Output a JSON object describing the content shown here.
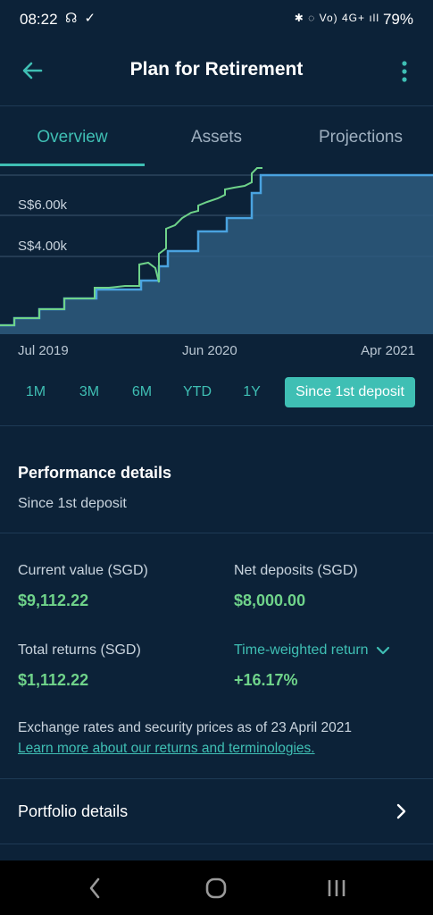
{
  "status_bar": {
    "time": "08:22",
    "battery": "79%",
    "left_icons": "☊ ✓",
    "right_icons": "✱ ◌ Vo) 4G+ ıll"
  },
  "app_bar": {
    "title": "Plan for Retirement"
  },
  "tabs": [
    {
      "label": "Overview",
      "active": true
    },
    {
      "label": "Assets",
      "active": false
    },
    {
      "label": "Projections",
      "active": false
    }
  ],
  "chart": {
    "y_labels": [
      "S$6.00k",
      "S$4.00k"
    ],
    "x_labels": [
      "Jul 2019",
      "Jun 2020",
      "Apr 2021"
    ]
  },
  "chart_data": {
    "type": "area",
    "x_labels": [
      "Jul 2019",
      "Jun 2020",
      "Apr 2021"
    ],
    "y_tick_labels": [
      "S$4.00k",
      "S$6.00k"
    ],
    "series": [
      {
        "values": [
          1000,
          1000,
          1000,
          1500,
          1500,
          2000,
          2000,
          2500,
          2500,
          3000,
          3000,
          3500,
          4000,
          5000,
          5500,
          6000,
          6500,
          7000,
          7500,
          8000,
          8000,
          8000
        ]
      },
      {
        "values": [
          1000,
          1000,
          1050,
          1520,
          1520,
          2010,
          2080,
          2540,
          2600,
          3100,
          3750,
          3500,
          4200,
          5200,
          5700,
          6150,
          6550,
          7150,
          7650,
          8600,
          9000,
          9112
        ]
      }
    ],
    "colors": {
      "deposits": "#4aa3e0",
      "value": "#6fd38a",
      "fill": "#2e5a7e"
    }
  },
  "ranges": [
    {
      "label": "1M",
      "selected": false
    },
    {
      "label": "3M",
      "selected": false
    },
    {
      "label": "6M",
      "selected": false
    },
    {
      "label": "YTD",
      "selected": false
    },
    {
      "label": "1Y",
      "selected": false
    },
    {
      "label": "Since 1st deposit",
      "selected": true
    }
  ],
  "performance": {
    "title": "Performance details",
    "subtitle": "Since 1st deposit",
    "current_value_label": "Current value (SGD)",
    "current_value": "$9,112.22",
    "net_deposits_label": "Net deposits (SGD)",
    "net_deposits": "$8,000.00",
    "total_returns_label": "Total returns (SGD)",
    "total_returns": "$1,112.22",
    "twr_label": "Time-weighted return",
    "twr_value": "+16.17%",
    "note": "Exchange rates and security prices as of 23 April 2021",
    "link": "Learn more about our returns and terminologies."
  },
  "portfolio": {
    "label": "Portfolio details"
  },
  "colors": {
    "background": "#0c2238",
    "accent": "#3fbfb4",
    "positive": "#6fd38a"
  }
}
